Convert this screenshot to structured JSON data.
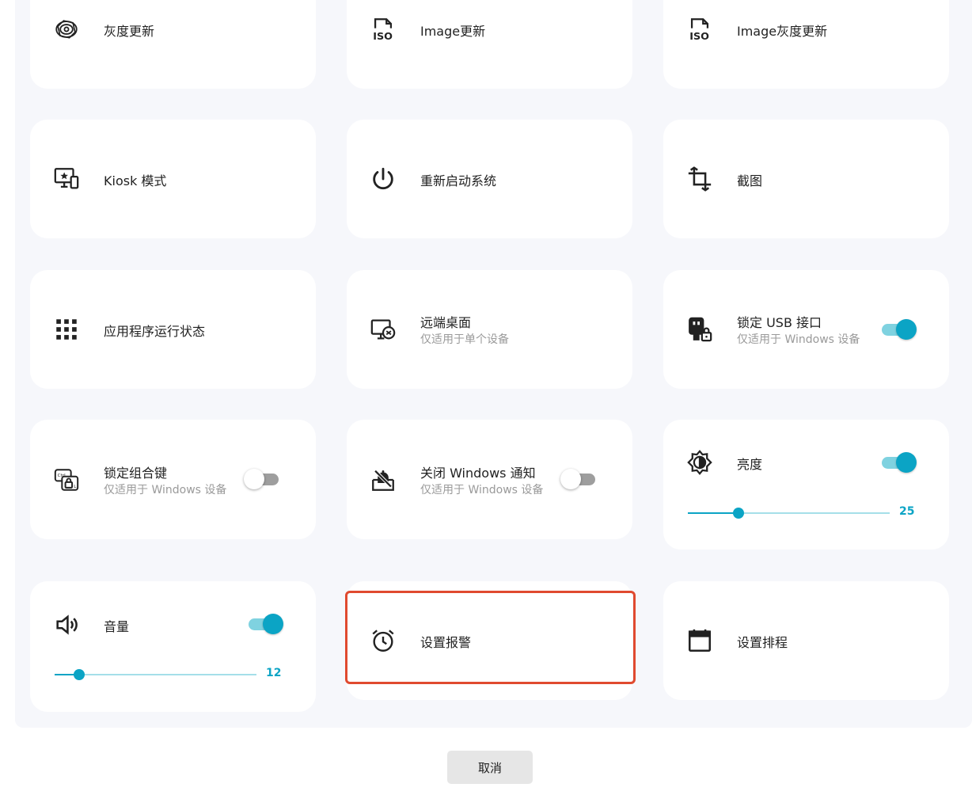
{
  "colors": {
    "accent": "#0ba4c5",
    "highlight": "#e04a2f"
  },
  "cards": {
    "gray_update": {
      "title": "灰度更新",
      "icon": "concentric-rings-icon"
    },
    "image_update": {
      "title": "Image更新",
      "icon": "iso-file-icon"
    },
    "image_gray_update": {
      "title": "Image灰度更新",
      "icon": "iso-file-icon"
    },
    "kiosk": {
      "title": "Kiosk 模式",
      "icon": "monitor-star-icon"
    },
    "restart": {
      "title": "重新启动系统",
      "icon": "power-icon"
    },
    "screenshot": {
      "title": "截图",
      "icon": "crop-icon"
    },
    "app_status": {
      "title": "应用程序运行状态",
      "icon": "apps-grid-icon"
    },
    "remote_desktop": {
      "title": "远端桌面",
      "subtitle": "仅适用于单个设备",
      "icon": "remote-desktop-icon"
    },
    "lock_usb": {
      "title": "锁定 USB 接口",
      "subtitle": "仅适用于 Windows 设备",
      "icon": "usb-lock-icon",
      "enabled": true
    },
    "lock_combo": {
      "title": "锁定组合键",
      "subtitle": "仅适用于 Windows 设备",
      "icon": "keyboard-lock-icon",
      "enabled": false
    },
    "close_notify": {
      "title": "关闭 Windows 通知",
      "subtitle": "仅适用于 Windows 设备",
      "icon": "notification-off-icon",
      "enabled": false
    },
    "brightness": {
      "title": "亮度",
      "icon": "brightness-icon",
      "enabled": true,
      "value": 25,
      "max": 100,
      "display": "25"
    },
    "volume": {
      "title": "音量",
      "icon": "volume-icon",
      "enabled": true,
      "value": 12,
      "max": 100,
      "display": "12"
    },
    "set_alarm": {
      "title": "设置报警",
      "icon": "alarm-clock-icon",
      "highlighted": true
    },
    "set_schedule": {
      "title": "设置排程",
      "icon": "calendar-icon"
    }
  },
  "footer": {
    "cancel_label": "取消"
  }
}
